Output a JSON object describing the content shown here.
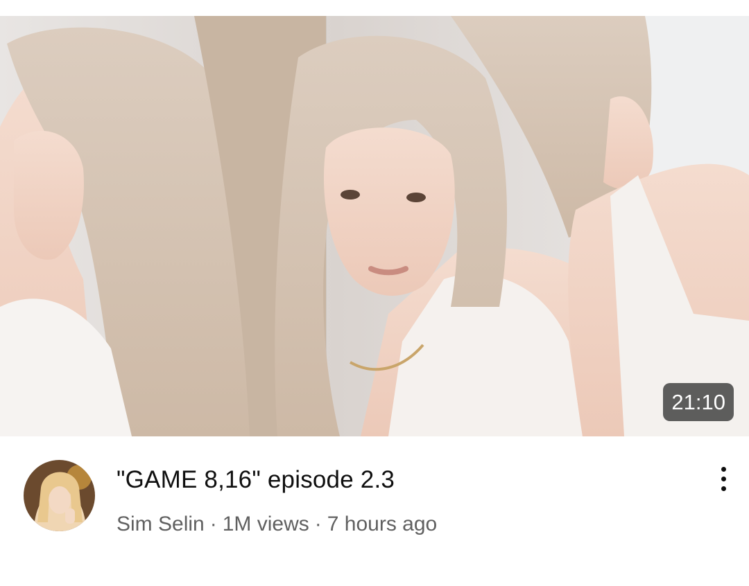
{
  "video": {
    "title": "\"GAME 8,16\" episode 2.3",
    "duration": "21:10",
    "channel": "Sim Selin",
    "views": "1M views",
    "age": "7 hours ago",
    "separator": "·"
  },
  "icons": {
    "more": "more-vertical-icon",
    "avatar": "channel-avatar"
  },
  "colors": {
    "title": "#0f0f0f",
    "secondary": "#606060",
    "duration_bg": "#3c3c3c"
  }
}
